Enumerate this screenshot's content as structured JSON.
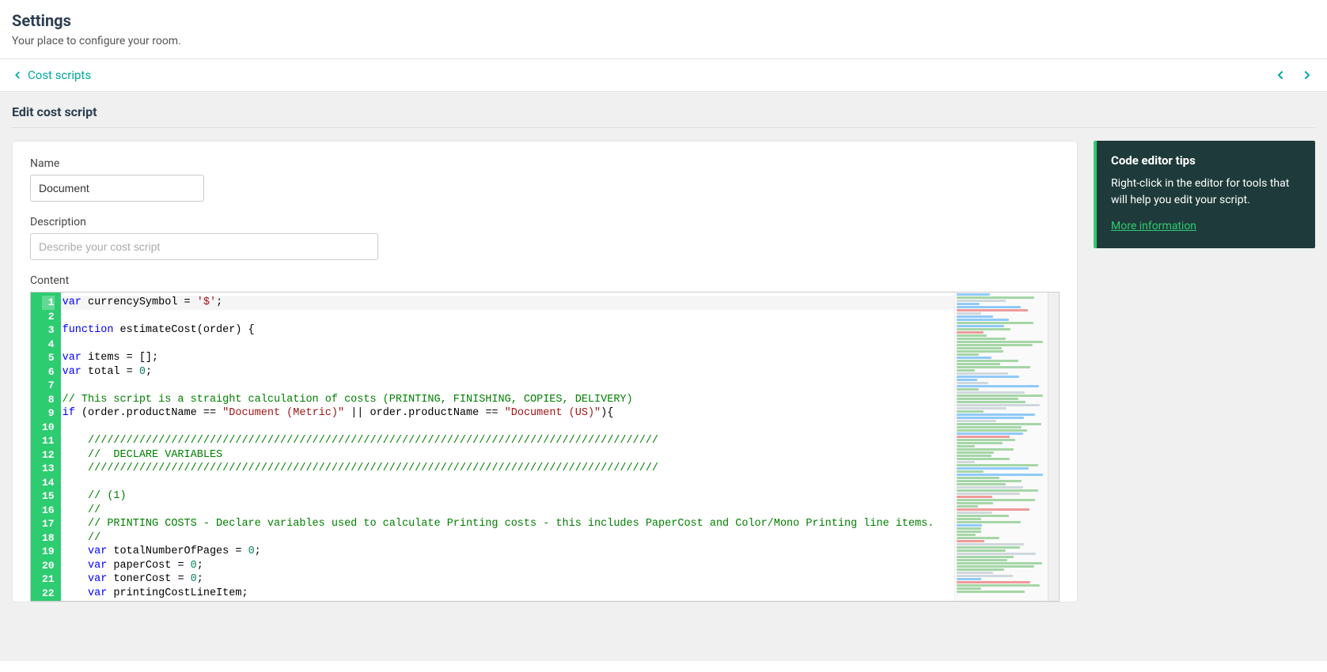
{
  "header": {
    "title": "Settings",
    "subtitle": "Your place to configure your room."
  },
  "breadcrumb": {
    "back_label": "Cost scripts"
  },
  "section": {
    "title": "Edit cost script"
  },
  "form": {
    "name_label": "Name",
    "name_value": "Document",
    "description_label": "Description",
    "description_placeholder": "Describe your cost script",
    "description_value": "",
    "content_label": "Content"
  },
  "tips": {
    "title": "Code editor tips",
    "body": "Right-click in the editor for tools that will help you edit your script.",
    "link": "More information"
  },
  "editor": {
    "line_count": 22,
    "active_line": 1,
    "code_lines": [
      {
        "t": "code",
        "tokens": [
          [
            "kw",
            "var"
          ],
          [
            "id",
            " currencySymbol = "
          ],
          [
            "str",
            "'$'"
          ],
          [
            "id",
            ";"
          ]
        ]
      },
      {
        "t": "blank"
      },
      {
        "t": "code",
        "tokens": [
          [
            "kw",
            "function"
          ],
          [
            "id",
            " estimateCost(order) {"
          ]
        ]
      },
      {
        "t": "blank"
      },
      {
        "t": "code",
        "tokens": [
          [
            "kw",
            "var"
          ],
          [
            "id",
            " items = [];"
          ]
        ]
      },
      {
        "t": "code",
        "tokens": [
          [
            "kw",
            "var"
          ],
          [
            "id",
            " total = "
          ],
          [
            "num",
            "0"
          ],
          [
            "id",
            ";"
          ]
        ]
      },
      {
        "t": "blank"
      },
      {
        "t": "code",
        "tokens": [
          [
            "com",
            "// This script is a straight calculation of costs (PRINTING, FINISHING, COPIES, DELIVERY)"
          ]
        ]
      },
      {
        "t": "code",
        "tokens": [
          [
            "kw",
            "if"
          ],
          [
            "id",
            " (order.productName == "
          ],
          [
            "str",
            "\"Document (Metric)\""
          ],
          [
            "id",
            " || order.productName == "
          ],
          [
            "str",
            "\"Document (US)\""
          ],
          [
            "id",
            "){"
          ]
        ]
      },
      {
        "t": "blank"
      },
      {
        "t": "code",
        "indent": 1,
        "tokens": [
          [
            "com",
            "/////////////////////////////////////////////////////////////////////////////////////////"
          ]
        ]
      },
      {
        "t": "code",
        "indent": 1,
        "tokens": [
          [
            "com",
            "//  DECLARE VARIABLES"
          ]
        ]
      },
      {
        "t": "code",
        "indent": 1,
        "tokens": [
          [
            "com",
            "/////////////////////////////////////////////////////////////////////////////////////////"
          ]
        ]
      },
      {
        "t": "blank"
      },
      {
        "t": "code",
        "indent": 1,
        "tokens": [
          [
            "com",
            "// (1)"
          ]
        ]
      },
      {
        "t": "code",
        "indent": 1,
        "tokens": [
          [
            "com",
            "//"
          ]
        ]
      },
      {
        "t": "code",
        "indent": 1,
        "tokens": [
          [
            "com",
            "// PRINTING COSTS - Declare variables used to calculate Printing costs - this includes PaperCost and Color/Mono Printing line items."
          ]
        ]
      },
      {
        "t": "code",
        "indent": 1,
        "tokens": [
          [
            "com",
            "//"
          ]
        ]
      },
      {
        "t": "code",
        "indent": 1,
        "tokens": [
          [
            "kw",
            "var"
          ],
          [
            "id",
            " totalNumberOfPages = "
          ],
          [
            "num",
            "0"
          ],
          [
            "id",
            ";"
          ]
        ]
      },
      {
        "t": "code",
        "indent": 1,
        "tokens": [
          [
            "kw",
            "var"
          ],
          [
            "id",
            " paperCost = "
          ],
          [
            "num",
            "0"
          ],
          [
            "id",
            ";"
          ]
        ]
      },
      {
        "t": "code",
        "indent": 1,
        "tokens": [
          [
            "kw",
            "var"
          ],
          [
            "id",
            " tonerCost = "
          ],
          [
            "num",
            "0"
          ],
          [
            "id",
            ";"
          ]
        ]
      },
      {
        "t": "code",
        "indent": 1,
        "tokens": [
          [
            "kw",
            "var"
          ],
          [
            "id",
            " printingCostLineItem;"
          ]
        ]
      }
    ]
  }
}
